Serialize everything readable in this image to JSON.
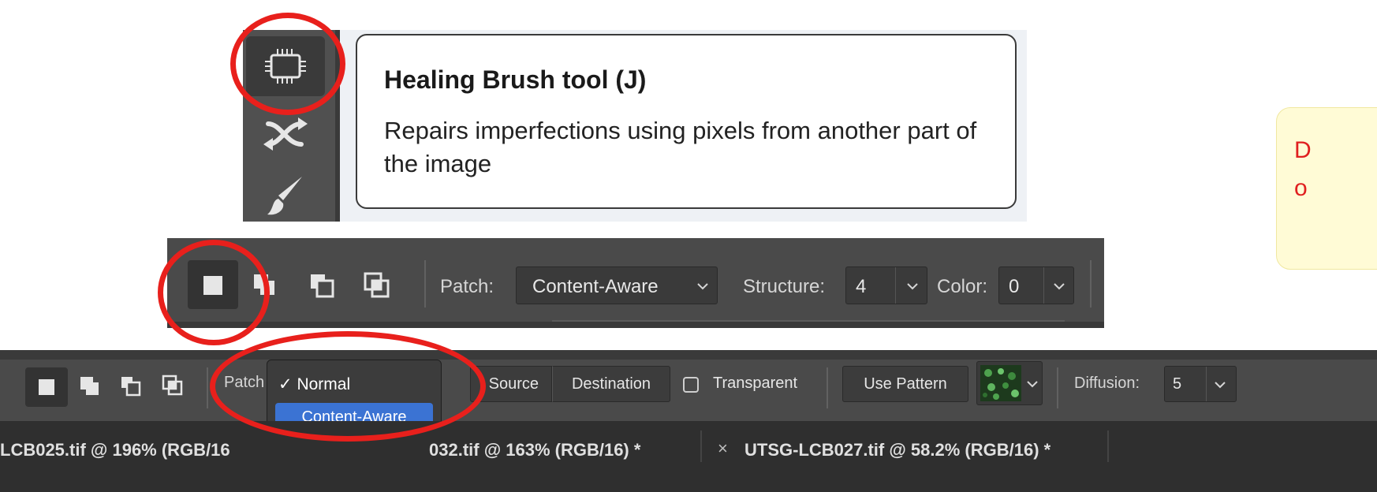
{
  "tooltip": {
    "title": "Healing Brush tool (J)",
    "description": "Repairs imperfections using pixels from another part of the image"
  },
  "note_box": {
    "text": "D\no"
  },
  "options_bar_top": {
    "patch_label": "Patch:",
    "patch_value": "Content-Aware",
    "structure_label": "Structure:",
    "structure_value": "4",
    "color_label": "Color:",
    "color_value": "0"
  },
  "options_bar_full": {
    "patch_label": "Patch",
    "menu": {
      "check": "✓",
      "normal": "Normal",
      "content_aware": "Content-Aware"
    },
    "source_label": "Source",
    "destination_label": "Destination",
    "transparent_label": "Transparent",
    "use_pattern_label": "Use Pattern",
    "diffusion_label": "Diffusion:",
    "diffusion_value": "5"
  },
  "tabs": [
    {
      "label": "LCB025.tif @ 196% (RGB/16"
    },
    {
      "label": "032.tif @ 163% (RGB/16) *"
    },
    {
      "close": "×",
      "label": "UTSG-LCB027.tif @ 58.2% (RGB/16) *"
    }
  ],
  "colors": {
    "annotation_red": "#e8201c",
    "menu_highlight": "#3b73d3",
    "note_text": "#e02020",
    "note_bg": "#fffbd6"
  },
  "icons": {
    "healing": "healing-brush-icon",
    "patch": "patch-tool-icon",
    "brush": "brush-icon",
    "selection_new": "new-selection-icon",
    "selection_add": "add-selection-icon",
    "selection_subtract": "subtract-selection-icon",
    "selection_intersect": "intersect-selection-icon",
    "chevron": "chevron-down-icon",
    "pattern": "pattern-thumbnail-icon"
  }
}
